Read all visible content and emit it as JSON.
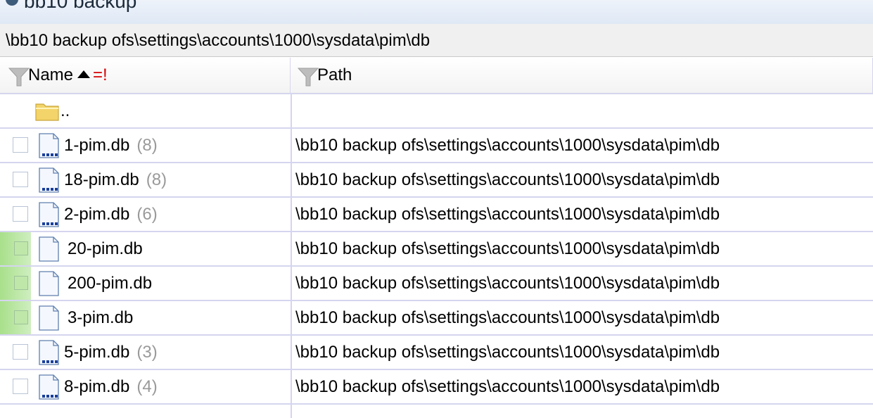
{
  "window": {
    "title": "bb10 backup"
  },
  "path_bar": {
    "path": "\\bb10 backup ofs\\settings\\accounts\\1000\\sysdata\\pim\\db"
  },
  "columns": {
    "name": {
      "label": "Name",
      "flag": "=!"
    },
    "path": {
      "label": "Path"
    }
  },
  "parent_row": {
    "label": ".."
  },
  "rows": [
    {
      "name": "1-pim.db",
      "count": "(8)",
      "path": "\\bb10 backup ofs\\settings\\accounts\\1000\\sysdata\\pim\\db",
      "marked": false,
      "has_children": true
    },
    {
      "name": "18-pim.db",
      "count": "(8)",
      "path": "\\bb10 backup ofs\\settings\\accounts\\1000\\sysdata\\pim\\db",
      "marked": false,
      "has_children": true
    },
    {
      "name": "2-pim.db",
      "count": "(6)",
      "path": "\\bb10 backup ofs\\settings\\accounts\\1000\\sysdata\\pim\\db",
      "marked": false,
      "has_children": true
    },
    {
      "name": "20-pim.db",
      "count": "",
      "path": "\\bb10 backup ofs\\settings\\accounts\\1000\\sysdata\\pim\\db",
      "marked": true,
      "has_children": false
    },
    {
      "name": "200-pim.db",
      "count": "",
      "path": "\\bb10 backup ofs\\settings\\accounts\\1000\\sysdata\\pim\\db",
      "marked": true,
      "has_children": false
    },
    {
      "name": "3-pim.db",
      "count": "",
      "path": "\\bb10 backup ofs\\settings\\accounts\\1000\\sysdata\\pim\\db",
      "marked": true,
      "has_children": false
    },
    {
      "name": "5-pim.db",
      "count": "(3)",
      "path": "\\bb10 backup ofs\\settings\\accounts\\1000\\sysdata\\pim\\db",
      "marked": false,
      "has_children": true
    },
    {
      "name": "8-pim.db",
      "count": "(4)",
      "path": "\\bb10 backup ofs\\settings\\accounts\\1000\\sysdata\\pim\\db",
      "marked": false,
      "has_children": true
    }
  ],
  "colors": {
    "grid_line": "#d5d5ef",
    "marked_green": "#a8e08a",
    "count_gray": "#9a9a9a",
    "flag_red": "#d40000"
  }
}
